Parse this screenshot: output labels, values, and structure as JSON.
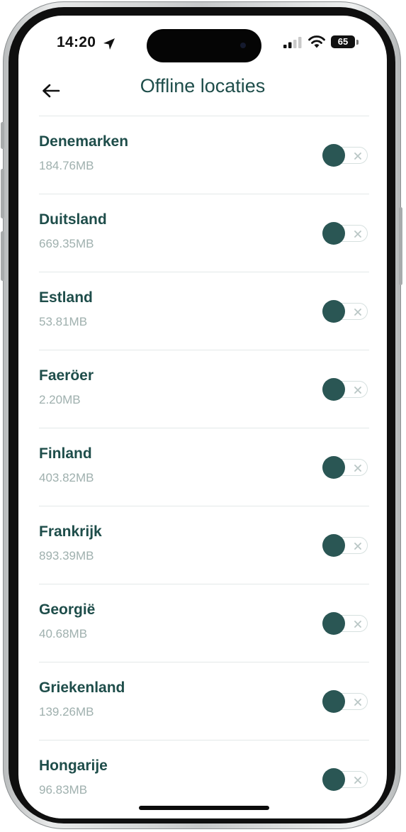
{
  "status_bar": {
    "time": "14:20",
    "battery": "65",
    "location_icon": "location-arrow-icon",
    "signal_icon": "cellular-signal-icon",
    "wifi_icon": "wifi-icon"
  },
  "header": {
    "back_icon": "arrow-left-icon",
    "title": "Offline locaties"
  },
  "colors": {
    "primary": "#1e4d4a",
    "toggle_knob": "#2a5654",
    "secondary_text": "#9fb0ae",
    "divider": "#e3e8e8"
  },
  "locations": [
    {
      "name": "Denemarken",
      "size": "184.76MB",
      "enabled": false
    },
    {
      "name": "Duitsland",
      "size": "669.35MB",
      "enabled": false
    },
    {
      "name": "Estland",
      "size": "53.81MB",
      "enabled": false
    },
    {
      "name": "Faeröer",
      "size": "2.20MB",
      "enabled": false
    },
    {
      "name": "Finland",
      "size": "403.82MB",
      "enabled": false
    },
    {
      "name": "Frankrijk",
      "size": "893.39MB",
      "enabled": false
    },
    {
      "name": "Georgië",
      "size": "40.68MB",
      "enabled": false
    },
    {
      "name": "Griekenland",
      "size": "139.26MB",
      "enabled": false
    },
    {
      "name": "Hongarije",
      "size": "96.83MB",
      "enabled": false
    }
  ]
}
